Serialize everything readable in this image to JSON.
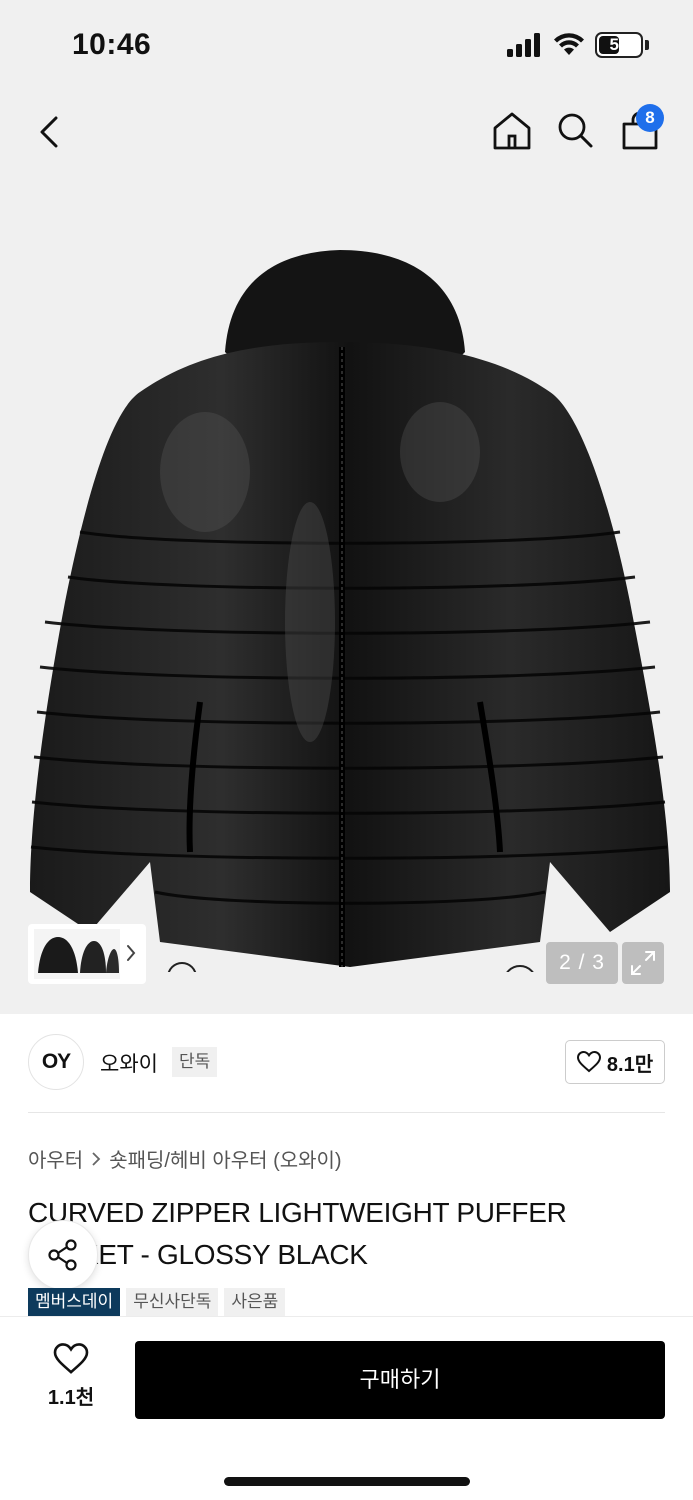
{
  "status_bar": {
    "time": "10:46",
    "battery_level": "51"
  },
  "header": {
    "cart_count": "8"
  },
  "gallery": {
    "page_indicator": "2 / 3"
  },
  "brand": {
    "logo_text": "OY",
    "name": "오와이",
    "tag": "단독",
    "like_count": "8.1만"
  },
  "breadcrumb": {
    "parent": "아우터",
    "current": "숏패딩/헤비 아우터 (오와이)"
  },
  "product": {
    "title": "CURVED ZIPPER LIGHTWEIGHT PUFFER JACKET - GLOSSY BLACK",
    "badges": [
      {
        "label": "멤버스데이",
        "style": "primary"
      },
      {
        "label": "무신사단독",
        "style": "normal"
      },
      {
        "label": "사은품",
        "style": "normal"
      }
    ]
  },
  "bottom_bar": {
    "wish_count": "1.1천",
    "buy_label": "구매하기"
  },
  "icons": {
    "back": "chevron-left-icon",
    "home": "home-icon",
    "search": "search-icon",
    "cart": "shopping-bag-icon",
    "expand": "expand-icon",
    "share": "share-icon",
    "heart": "heart-icon"
  },
  "colors": {
    "badge_primary": "#0d3a5c",
    "cart_badge": "#1f6feb",
    "buy_button": "#000000"
  }
}
